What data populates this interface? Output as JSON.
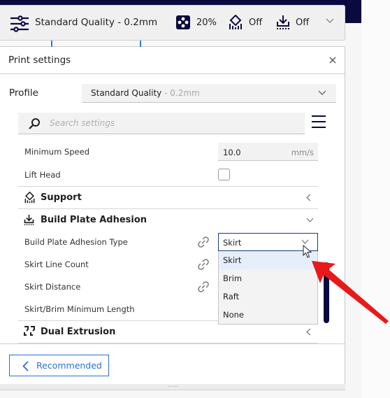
{
  "toolbar": {
    "profile_name": "Standard Quality - 0.2mm",
    "infill": {
      "icon": "infill-icon",
      "value": "20%"
    },
    "support": {
      "icon": "support-icon",
      "value": "Off"
    },
    "adhesion": {
      "icon": "adhesion-icon",
      "value": "Off"
    },
    "expand_icon": "chevron-down-icon"
  },
  "panel": {
    "title": "Print settings",
    "close_icon": "close-icon",
    "profile": {
      "label": "Profile",
      "selected_name": "Standard Quality",
      "selected_suffix": " - 0.2mm"
    },
    "search": {
      "placeholder": "Search settings",
      "value": ""
    },
    "menu_icon": "hamburger-menu-icon",
    "settings": [
      {
        "label": "Minimum Speed",
        "value": "10.0",
        "unit": "mm/s"
      },
      {
        "label": "Lift Head",
        "checked": false
      }
    ],
    "sections": [
      {
        "label": "Support",
        "icon": "support-icon",
        "expanded": false
      },
      {
        "label": "Build Plate Adhesion",
        "icon": "adhesion-icon",
        "expanded": true
      },
      {
        "label": "Dual Extrusion",
        "icon": "dual-extrusion-icon",
        "expanded": false
      }
    ],
    "adhesion_settings": [
      {
        "label": "Build Plate Adhesion Type",
        "linked": true,
        "value": "Skirt"
      },
      {
        "label": "Skirt Line Count",
        "linked": true
      },
      {
        "label": "Skirt Distance",
        "linked": true
      },
      {
        "label": "Skirt/Brim Minimum Length",
        "linked": false
      }
    ],
    "adhesion_type_dropdown": {
      "selected": "Skirt",
      "options": [
        "Skirt",
        "Brim",
        "Raft",
        "None"
      ],
      "highlighted": "Skirt"
    },
    "footer": {
      "recommended_label": "Recommended"
    }
  },
  "colors": {
    "accent": "#2a6fdb",
    "dark": "#0a0a3f",
    "annotation_arrow": "#e8191a"
  }
}
